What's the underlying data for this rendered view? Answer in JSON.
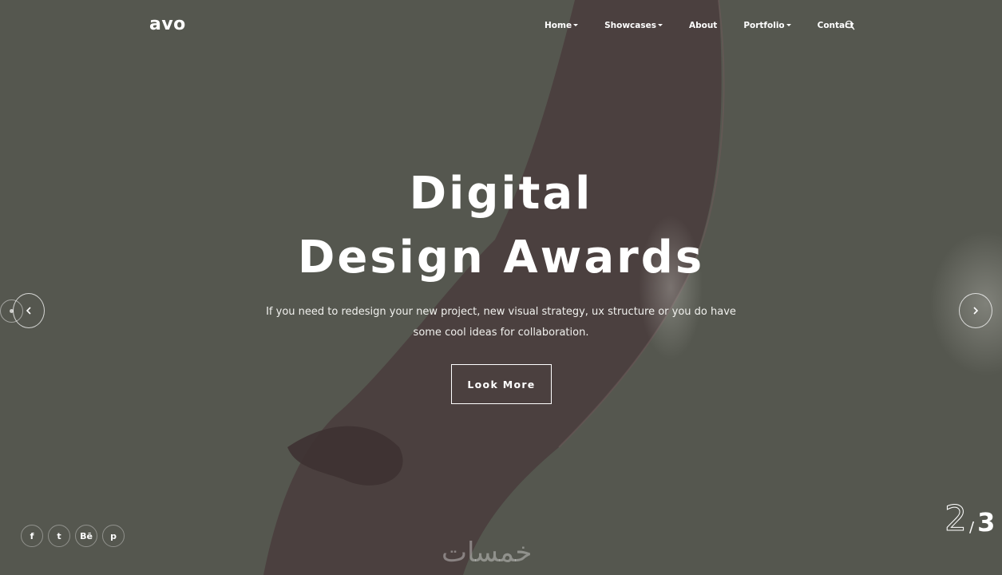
{
  "brand": {
    "logo": "avo"
  },
  "nav": {
    "items": [
      {
        "label": "Home",
        "has_dropdown": true
      },
      {
        "label": "Showcases",
        "has_dropdown": true
      },
      {
        "label": "About",
        "has_dropdown": false
      },
      {
        "label": "Portfolio",
        "has_dropdown": true
      },
      {
        "label": "Contact",
        "has_dropdown": false
      }
    ],
    "search_icon": "search-icon"
  },
  "hero": {
    "title_line1": "Digital",
    "title_line2": "Design Awards",
    "subtitle_line1": "If you need to redesign your new project, new visual strategy, ux structure or you do have",
    "subtitle_line2": "some cool ideas for collaboration.",
    "button": "Look More"
  },
  "slider": {
    "prev_icon": "chevron-left-icon",
    "next_icon": "chevron-right-icon",
    "current": "2",
    "separator": "/",
    "total": "3"
  },
  "social": [
    {
      "label": "f",
      "icon": "facebook-icon"
    },
    {
      "label": "t",
      "icon": "twitter-icon"
    },
    {
      "label": "Bē",
      "icon": "behance-icon"
    },
    {
      "label": "p",
      "icon": "pinterest-icon"
    }
  ],
  "watermark": "خمسات",
  "colors": {
    "background": "#55574f",
    "text": "#ffffff"
  }
}
